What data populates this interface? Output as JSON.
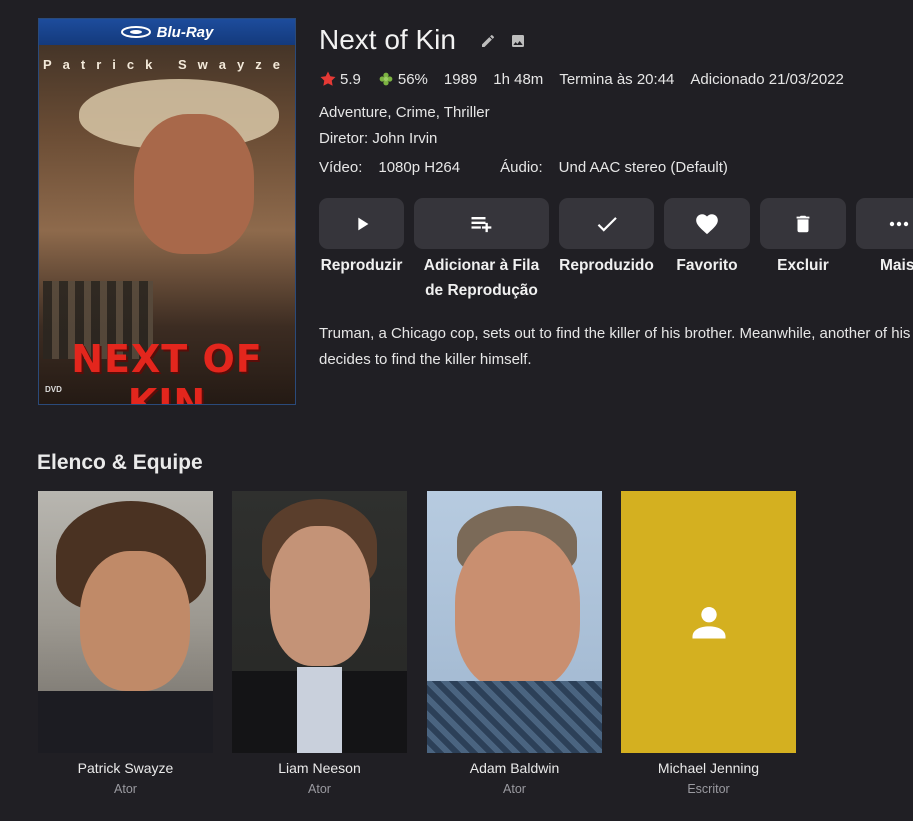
{
  "poster": {
    "format_label": "Blu-Ray",
    "actor_line": "Patrick Swayze",
    "title_art": "NEXT OF KIN",
    "logo_mark": "DVD"
  },
  "movie": {
    "title": "Next of Kin",
    "community_rating": "5.9",
    "critic_rating": "56%",
    "year": "1989",
    "runtime": "1h 48m",
    "ends_at": "Termina às 20:44",
    "added": "Adicionado 21/03/2022",
    "genres": "Adventure, Crime, Thriller",
    "director": "Diretor: John Irvin",
    "video_label": "Vídeo:",
    "video_value": "1080p H264",
    "audio_label": "Áudio:",
    "audio_value": "Und AAC stereo (Default)",
    "overview_line1": "Truman, a Chicago cop, sets out to find the killer of his brother. Meanwhile, another of his brothers",
    "overview_line2": "decides to find the killer himself."
  },
  "actions": {
    "play": "Reproduzir",
    "queue_line1": "Adicionar à Fila",
    "queue_line2": "de Reprodução",
    "played": "Reproduzido",
    "favorite": "Favorito",
    "delete": "Excluir",
    "more": "Mais"
  },
  "cast_section": {
    "title": "Elenco & Equipe",
    "people": [
      {
        "name": "Patrick Swayze",
        "role": "Ator"
      },
      {
        "name": "Liam Neeson",
        "role": "Ator"
      },
      {
        "name": "Adam Baldwin",
        "role": "Ator"
      },
      {
        "name": "Michael Jenning",
        "role": "Escritor"
      }
    ]
  },
  "icons": {
    "edit": "pencil-icon",
    "image": "image-icon",
    "star": "star-icon",
    "critic": "tomato-icon",
    "play": "play-icon",
    "queue": "playlist-add-icon",
    "played": "check-icon",
    "favorite": "heart-icon",
    "delete": "trash-icon",
    "more": "more-horizontal-icon",
    "person": "person-icon"
  },
  "colors": {
    "background": "#201f24",
    "button": "#36353b",
    "star": "#e53935",
    "critic": "#7cb342",
    "placeholder_card": "#d4b020",
    "poster_border": "#2a4a7a"
  }
}
